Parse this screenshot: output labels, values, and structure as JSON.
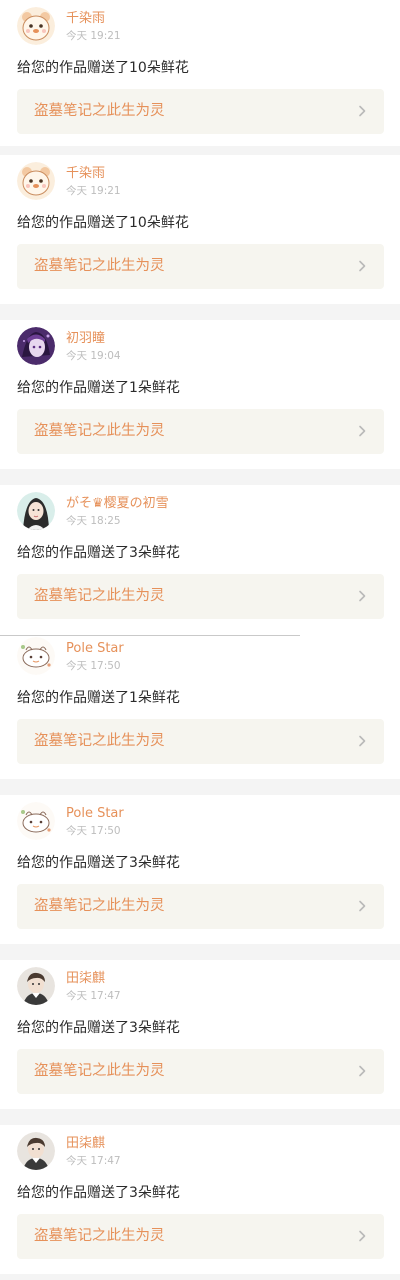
{
  "notifications": [
    {
      "username": "千染雨",
      "time": "今天 19:21",
      "message": "给您的作品赠送了10朵鲜花",
      "work_title": "盗墓笔记之此生为灵",
      "avatar_icon": "cartoon-bear-avatar-icon"
    },
    {
      "username": "千染雨",
      "time": "今天 19:21",
      "message": "给您的作品赠送了10朵鲜花",
      "work_title": "盗墓笔记之此生为灵",
      "avatar_icon": "cartoon-bear-avatar-icon"
    },
    {
      "username": "初羽瞳",
      "time": "今天 19:04",
      "message": "给您的作品赠送了1朵鲜花",
      "work_title": "盗墓笔记之此生为灵",
      "avatar_icon": "anime-girl-avatar-icon"
    },
    {
      "username": "がそ♛樱夏の初雪",
      "time": "今天 18:25",
      "message": "给您的作品赠送了3朵鲜花",
      "work_title": "盗墓笔记之此生为灵",
      "avatar_icon": "girl-portrait-avatar-icon"
    },
    {
      "username": "Pole Star",
      "time": "今天 17:50",
      "message": "给您的作品赠送了1朵鲜花",
      "work_title": "盗墓笔记之此生为灵",
      "avatar_icon": "doodle-animal-avatar-icon"
    },
    {
      "username": "Pole Star",
      "time": "今天 17:50",
      "message": "给您的作品赠送了3朵鲜花",
      "work_title": "盗墓笔记之此生为灵",
      "avatar_icon": "doodle-animal-avatar-icon"
    },
    {
      "username": "田柒麒",
      "time": "今天 17:47",
      "message": "给您的作品赠送了3朵鲜花",
      "work_title": "盗墓笔记之此生为灵",
      "avatar_icon": "person-portrait-avatar-icon"
    },
    {
      "username": "田柒麒",
      "time": "今天 17:47",
      "message": "给您的作品赠送了3朵鲜花",
      "work_title": "盗墓笔记之此生为灵",
      "avatar_icon": "person-portrait-avatar-icon"
    }
  ],
  "colors": {
    "accent": "#e6915a",
    "page_background": "#f4f4f4",
    "card_background": "#ffffff",
    "link_box_background": "#f6f5ef",
    "timestamp": "#bdbdbd",
    "message_text": "#2b2b2b"
  }
}
